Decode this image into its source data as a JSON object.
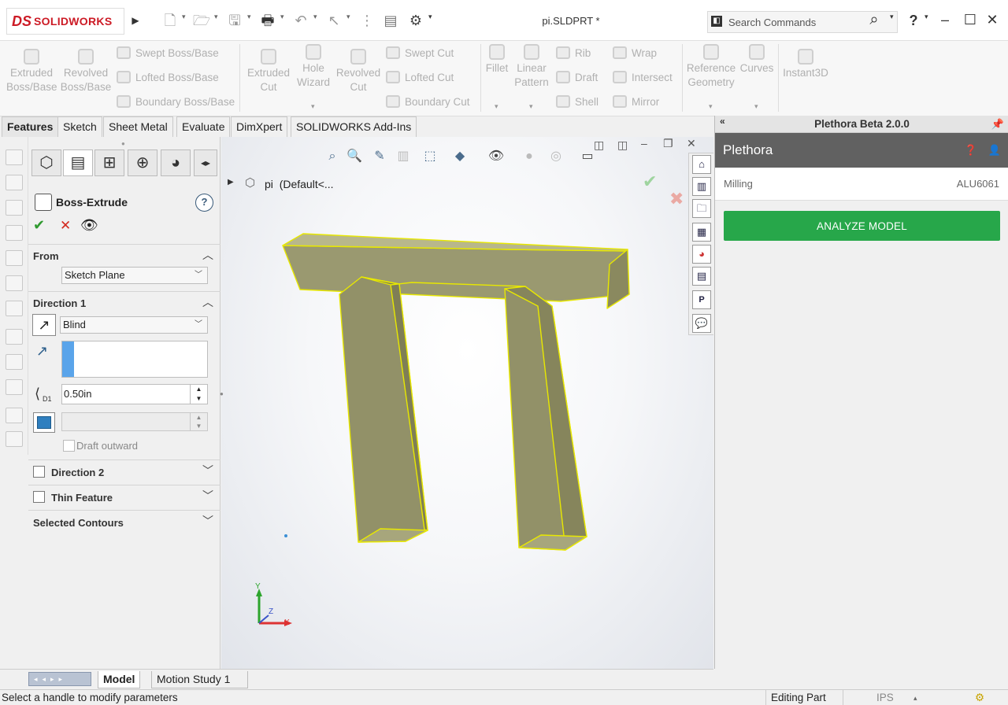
{
  "app": {
    "logo_ds": "DS",
    "logo_text": "SOLIDWORKS",
    "document_title": "pi.SLDPRT *"
  },
  "search": {
    "placeholder": "Search Commands"
  },
  "commands": {
    "extruded_boss": [
      "Extruded",
      "Boss/Base"
    ],
    "revolved_boss": [
      "Revolved",
      "Boss/Base"
    ],
    "swept_boss": "Swept Boss/Base",
    "lofted_boss": "Lofted Boss/Base",
    "boundary_boss": "Boundary Boss/Base",
    "extruded_cut": [
      "Extruded",
      "Cut"
    ],
    "hole_wizard": [
      "Hole",
      "Wizard"
    ],
    "revolved_cut": [
      "Revolved",
      "Cut"
    ],
    "swept_cut": "Swept Cut",
    "lofted_cut": "Lofted Cut",
    "boundary_cut": "Boundary Cut",
    "fillet": "Fillet",
    "linear_pattern": [
      "Linear",
      "Pattern"
    ],
    "rib": "Rib",
    "draft": "Draft",
    "shell": "Shell",
    "wrap": "Wrap",
    "intersect": "Intersect",
    "mirror": "Mirror",
    "reference_geometry": [
      "Reference",
      "Geometry"
    ],
    "curves": "Curves",
    "instant3d": "Instant3D"
  },
  "tabs": [
    "Features",
    "Sketch",
    "Sheet Metal",
    "Evaluate",
    "DimXpert",
    "SOLIDWORKS Add-Ins"
  ],
  "property_manager": {
    "title": "Boss-Extrude",
    "help": "?",
    "from_label": "From",
    "from_value": "Sketch Plane",
    "direction1_label": "Direction 1",
    "end_condition": "Blind",
    "depth_value": "0.50in",
    "depth_tag": "D1",
    "draft_outward": "Draft outward",
    "direction2_label": "Direction 2",
    "thin_feature_label": "Thin Feature",
    "selected_contours_label": "Selected Contours"
  },
  "feature_tree": {
    "part_name": "pi",
    "config": "(Default<..."
  },
  "triad": {
    "x": "X",
    "y": "Y",
    "z": "Z"
  },
  "plethora": {
    "pane_title": "Plethora Beta 2.0.0",
    "brand": "Plethora",
    "process": "Milling",
    "material": "ALU6061",
    "analyze_label": "ANALYZE MODEL",
    "accent": "#27a74a"
  },
  "bottom_tabs": [
    "Model",
    "Motion Study 1"
  ],
  "status": {
    "message": "Select a handle to modify parameters",
    "mode": "Editing Part",
    "units": "IPS"
  },
  "colors": {
    "solidworks_red": "#cc1a25",
    "plethora_header": "#616161",
    "model_fill": "#9c9b73",
    "model_edge": "#e8e800"
  }
}
